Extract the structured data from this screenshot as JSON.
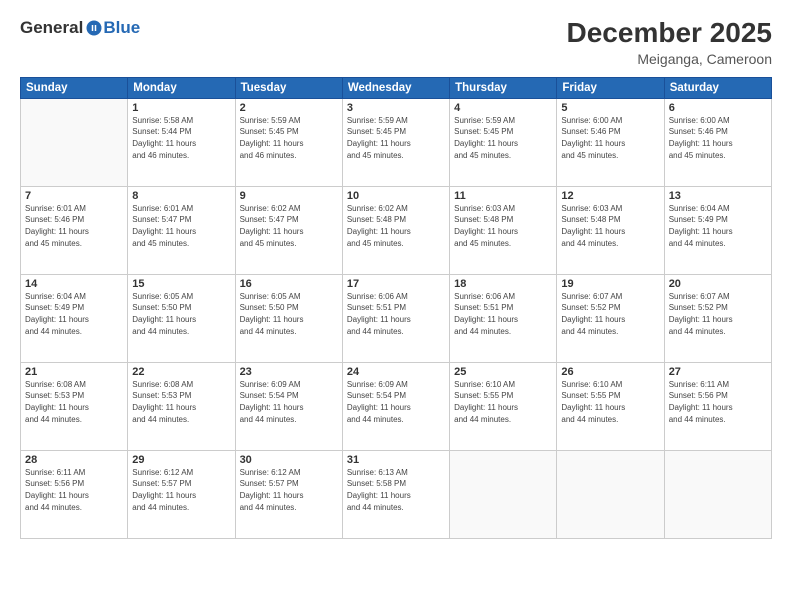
{
  "header": {
    "logo_general": "General",
    "logo_blue": "Blue",
    "month_title": "December 2025",
    "location": "Meiganga, Cameroon"
  },
  "weekdays": [
    "Sunday",
    "Monday",
    "Tuesday",
    "Wednesday",
    "Thursday",
    "Friday",
    "Saturday"
  ],
  "weeks": [
    [
      {
        "day": "",
        "info": ""
      },
      {
        "day": "1",
        "info": "Sunrise: 5:58 AM\nSunset: 5:44 PM\nDaylight: 11 hours\nand 46 minutes."
      },
      {
        "day": "2",
        "info": "Sunrise: 5:59 AM\nSunset: 5:45 PM\nDaylight: 11 hours\nand 46 minutes."
      },
      {
        "day": "3",
        "info": "Sunrise: 5:59 AM\nSunset: 5:45 PM\nDaylight: 11 hours\nand 45 minutes."
      },
      {
        "day": "4",
        "info": "Sunrise: 5:59 AM\nSunset: 5:45 PM\nDaylight: 11 hours\nand 45 minutes."
      },
      {
        "day": "5",
        "info": "Sunrise: 6:00 AM\nSunset: 5:46 PM\nDaylight: 11 hours\nand 45 minutes."
      },
      {
        "day": "6",
        "info": "Sunrise: 6:00 AM\nSunset: 5:46 PM\nDaylight: 11 hours\nand 45 minutes."
      }
    ],
    [
      {
        "day": "7",
        "info": "Sunrise: 6:01 AM\nSunset: 5:46 PM\nDaylight: 11 hours\nand 45 minutes."
      },
      {
        "day": "8",
        "info": "Sunrise: 6:01 AM\nSunset: 5:47 PM\nDaylight: 11 hours\nand 45 minutes."
      },
      {
        "day": "9",
        "info": "Sunrise: 6:02 AM\nSunset: 5:47 PM\nDaylight: 11 hours\nand 45 minutes."
      },
      {
        "day": "10",
        "info": "Sunrise: 6:02 AM\nSunset: 5:48 PM\nDaylight: 11 hours\nand 45 minutes."
      },
      {
        "day": "11",
        "info": "Sunrise: 6:03 AM\nSunset: 5:48 PM\nDaylight: 11 hours\nand 45 minutes."
      },
      {
        "day": "12",
        "info": "Sunrise: 6:03 AM\nSunset: 5:48 PM\nDaylight: 11 hours\nand 44 minutes."
      },
      {
        "day": "13",
        "info": "Sunrise: 6:04 AM\nSunset: 5:49 PM\nDaylight: 11 hours\nand 44 minutes."
      }
    ],
    [
      {
        "day": "14",
        "info": "Sunrise: 6:04 AM\nSunset: 5:49 PM\nDaylight: 11 hours\nand 44 minutes."
      },
      {
        "day": "15",
        "info": "Sunrise: 6:05 AM\nSunset: 5:50 PM\nDaylight: 11 hours\nand 44 minutes."
      },
      {
        "day": "16",
        "info": "Sunrise: 6:05 AM\nSunset: 5:50 PM\nDaylight: 11 hours\nand 44 minutes."
      },
      {
        "day": "17",
        "info": "Sunrise: 6:06 AM\nSunset: 5:51 PM\nDaylight: 11 hours\nand 44 minutes."
      },
      {
        "day": "18",
        "info": "Sunrise: 6:06 AM\nSunset: 5:51 PM\nDaylight: 11 hours\nand 44 minutes."
      },
      {
        "day": "19",
        "info": "Sunrise: 6:07 AM\nSunset: 5:52 PM\nDaylight: 11 hours\nand 44 minutes."
      },
      {
        "day": "20",
        "info": "Sunrise: 6:07 AM\nSunset: 5:52 PM\nDaylight: 11 hours\nand 44 minutes."
      }
    ],
    [
      {
        "day": "21",
        "info": "Sunrise: 6:08 AM\nSunset: 5:53 PM\nDaylight: 11 hours\nand 44 minutes."
      },
      {
        "day": "22",
        "info": "Sunrise: 6:08 AM\nSunset: 5:53 PM\nDaylight: 11 hours\nand 44 minutes."
      },
      {
        "day": "23",
        "info": "Sunrise: 6:09 AM\nSunset: 5:54 PM\nDaylight: 11 hours\nand 44 minutes."
      },
      {
        "day": "24",
        "info": "Sunrise: 6:09 AM\nSunset: 5:54 PM\nDaylight: 11 hours\nand 44 minutes."
      },
      {
        "day": "25",
        "info": "Sunrise: 6:10 AM\nSunset: 5:55 PM\nDaylight: 11 hours\nand 44 minutes."
      },
      {
        "day": "26",
        "info": "Sunrise: 6:10 AM\nSunset: 5:55 PM\nDaylight: 11 hours\nand 44 minutes."
      },
      {
        "day": "27",
        "info": "Sunrise: 6:11 AM\nSunset: 5:56 PM\nDaylight: 11 hours\nand 44 minutes."
      }
    ],
    [
      {
        "day": "28",
        "info": "Sunrise: 6:11 AM\nSunset: 5:56 PM\nDaylight: 11 hours\nand 44 minutes."
      },
      {
        "day": "29",
        "info": "Sunrise: 6:12 AM\nSunset: 5:57 PM\nDaylight: 11 hours\nand 44 minutes."
      },
      {
        "day": "30",
        "info": "Sunrise: 6:12 AM\nSunset: 5:57 PM\nDaylight: 11 hours\nand 44 minutes."
      },
      {
        "day": "31",
        "info": "Sunrise: 6:13 AM\nSunset: 5:58 PM\nDaylight: 11 hours\nand 44 minutes."
      },
      {
        "day": "",
        "info": ""
      },
      {
        "day": "",
        "info": ""
      },
      {
        "day": "",
        "info": ""
      }
    ]
  ]
}
